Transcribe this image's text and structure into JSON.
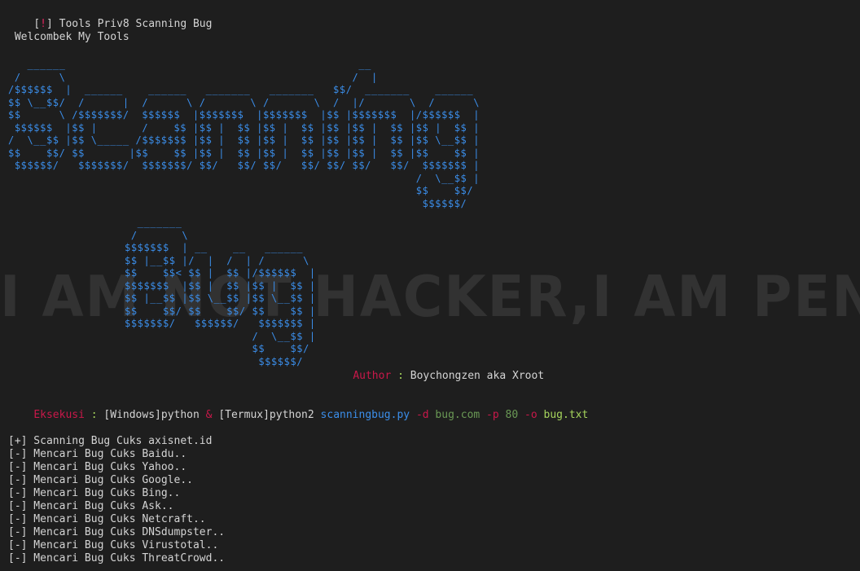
{
  "header": {
    "bracket_open": "[",
    "bang": "!",
    "bracket_close": "]",
    "title": " Tools Priv8 Scanning Bug"
  },
  "welcome": " Welcombek My Tools",
  "ascii": {
    "scanning_art": "   ______                                              __\n /      \\                                             /  |\n/$$$$$$  |  ______    ______   _______   _______   $$/  _______    ______\n$$ \\__$$/  /      |  /      \\ /       \\ /       \\  /  |/       \\  /      \\\n$$      \\ /$$$$$$$/  $$$$$$  |$$$$$$$  |$$$$$$$  |$$ |$$$$$$$  |/$$$$$$  |\n $$$$$$  |$$ |       /    $$ |$$ |  $$ |$$ |  $$ |$$ |$$ |  $$ |$$ |  $$ |\n/  \\__$$ |$$ \\_____ /$$$$$$$ |$$ |  $$ |$$ |  $$ |$$ |$$ |  $$ |$$ \\__$$ |\n$$    $$/ $$       |$$    $$ |$$ |  $$ |$$ |  $$ |$$ |$$ |  $$ |$$    $$ |\n $$$$$$/   $$$$$$$/  $$$$$$$/ $$/   $$/ $$/   $$/ $$/ $$/   $$/  $$$$$$$ |\n                                                                /  \\__$$ |\n                                                                $$    $$/\n                                                                 $$$$$$/",
    "bug_art": "  _______\n /       \\\n$$$$$$$  | __    __   ______\n$$ |__$$ |/  |  /  | /      \\\n$$    $$< $$ |  $$ |/$$$$$$  |\n$$$$$$$  |$$ |  $$ |$$ |  $$ |\n$$ |__$$ |$$ \\__$$ |$$ \\__$$ |\n$$    $$/ $$    $$/ $$    $$ |\n$$$$$$$/   $$$$$$/   $$$$$$$ |\n                    /  \\__$$ |\n                    $$    $$/\n                     $$$$$$/"
  },
  "author": {
    "label": "Author",
    "separator": " : ",
    "value": "Boychongzen aka Xroot"
  },
  "watermark": "I AM NOT HACKER,I AM PENT",
  "command": {
    "label": "Eksekusi",
    "separator": " : ",
    "windows": "[Windows]python",
    "amp": " & ",
    "termux": "[Termux]python2",
    "script": " scanningbug.py",
    "flag_d": " -d",
    "domain": " bug.com",
    "flag_p": " -p",
    "port": " 80",
    "flag_o": " -o",
    "output": " bug.txt"
  },
  "results": [
    "[+] Scanning Bug Cuks axisnet.id",
    "[-] Mencari Bug Cuks Baidu..",
    "[-] Mencari Bug Cuks Yahoo..",
    "[-] Mencari Bug Cuks Google..",
    "[-] Mencari Bug Cuks Bing..",
    "[-] Mencari Bug Cuks Ask..",
    "[-] Mencari Bug Cuks Netcraft..",
    "[-] Mencari Bug Cuks DNSdumpster..",
    "[-] Mencari Bug Cuks Virustotal..",
    "[-] Mencari Bug Cuks ThreatCrowd.."
  ],
  "colors": {
    "background": "#1e1e1e",
    "ascii_blue": "#3b8eea",
    "accent_red": "#e0245e",
    "text": "#d4d4d4",
    "flag_green": "#6a9955"
  }
}
